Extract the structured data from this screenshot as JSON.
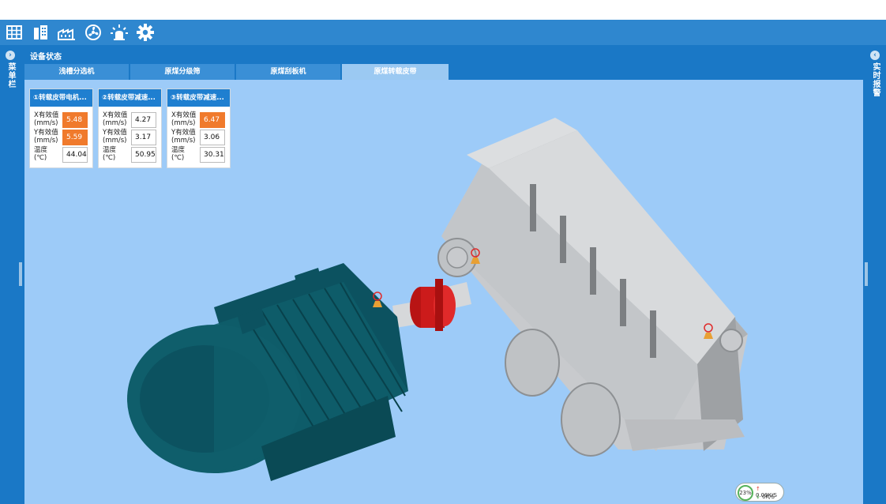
{
  "toolbar": {
    "icons": [
      "grid-icon",
      "building-icon",
      "factory-icon",
      "fan-icon",
      "alarm-light-icon",
      "gear-icon"
    ]
  },
  "left_panel": {
    "label": "菜单栏"
  },
  "right_panel": {
    "label": "实时报警"
  },
  "panel": {
    "title": "设备状态",
    "tabs": [
      {
        "label": "浅槽分选机",
        "active": false
      },
      {
        "label": "原煤分级筛",
        "active": false
      },
      {
        "label": "原煤刮板机",
        "active": false
      },
      {
        "label": "原煤转载皮带",
        "active": true
      }
    ]
  },
  "cards": [
    {
      "title": "①转载皮带电机...",
      "rows": [
        {
          "label": "X有效值\n(mm/s)",
          "value": "5.48",
          "alarm": true
        },
        {
          "label": "Y有效值\n(mm/s)",
          "value": "5.59",
          "alarm": true
        },
        {
          "label": "温度\n(℃)",
          "value": "44.04",
          "alarm": false
        }
      ]
    },
    {
      "title": "②转载皮带减速...",
      "rows": [
        {
          "label": "X有效值\n(mm/s)",
          "value": "4.27",
          "alarm": false
        },
        {
          "label": "Y有效值\n(mm/s)",
          "value": "3.17",
          "alarm": false
        },
        {
          "label": "温度\n(℃)",
          "value": "50.95",
          "alarm": false
        }
      ]
    },
    {
      "title": "③转载皮带减速...",
      "rows": [
        {
          "label": "X有效值\n(mm/s)",
          "value": "6.47",
          "alarm": true
        },
        {
          "label": "Y有效值\n(mm/s)",
          "value": "3.06",
          "alarm": false
        },
        {
          "label": "温度\n(℃)",
          "value": "30.31",
          "alarm": false
        }
      ]
    }
  ],
  "sensors": [
    {
      "label": "①"
    },
    {
      "label": "②"
    },
    {
      "label": "③"
    }
  ],
  "network": {
    "usage": "23%",
    "upload": "0.09K/S",
    "download": "0K/S"
  },
  "colors": {
    "header": "#2f87cf",
    "panel": "#1a78c6",
    "viewport": "#9dcbf8",
    "alarm": "#f07a2c",
    "motor": "#0f5e6b",
    "coupling": "#cc1b1b",
    "gearbox": "#b9bcc0"
  }
}
